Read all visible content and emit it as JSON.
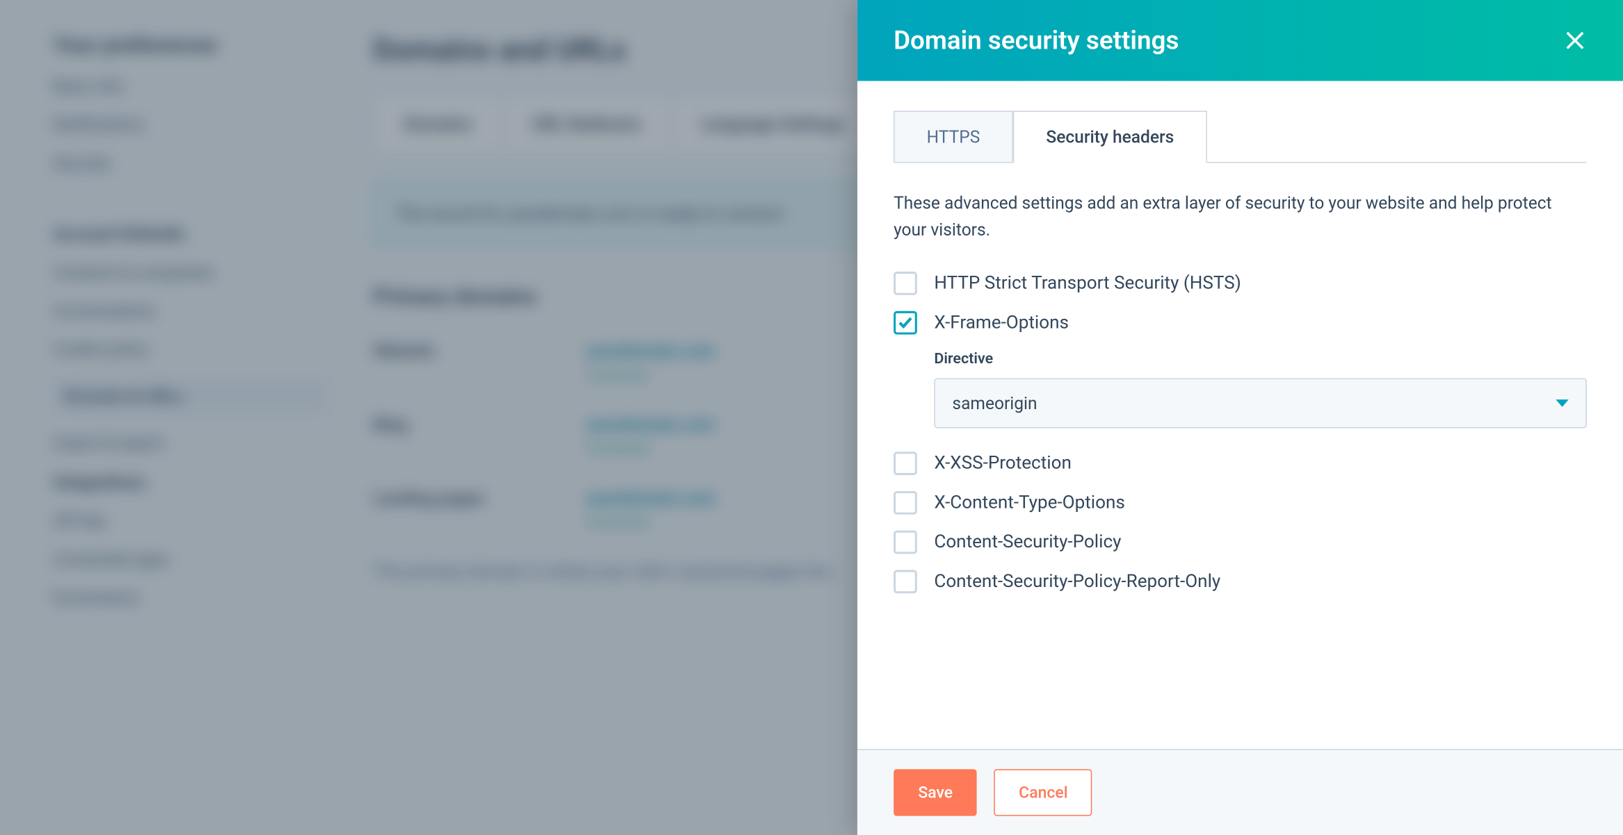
{
  "background": {
    "sidebar_heading": "Your preferences",
    "sidebar_items": [
      "Basic info",
      "Notifications",
      "Security"
    ],
    "sidebar_heading2": "Account Defaults",
    "sidebar_items2": [
      "Contacts & companies",
      "Conversations",
      "Cookie policy"
    ],
    "sidebar_selected": "Domains & URLs",
    "sidebar_items3": [
      "Import & export"
    ],
    "sidebar_heading3": "Integrations",
    "sidebar_items4": [
      "API key",
      "Connected apps",
      "Ecommerce"
    ],
    "page_title": "Domains and URLs",
    "tabs": [
      "Domains",
      "URL Redirects",
      "Language Settings"
    ],
    "alert": "The record for yourdomain.com is ready to connect.",
    "section": "Primary domains",
    "rows": [
      {
        "label": "Website",
        "value": "yourdomain.com",
        "status": "Connected"
      },
      {
        "label": "Blog",
        "value": "yourdomain.com",
        "status": "Connected"
      },
      {
        "label": "Landing pages",
        "value": "yourdomain.com",
        "status": "Connected"
      }
    ],
    "note": "The primary domain is where your site's canonical pages live."
  },
  "panel": {
    "title": "Domain security settings",
    "tabs": {
      "https": "HTTPS",
      "security_headers": "Security headers"
    },
    "description": "These advanced settings add an extra layer of security to your website and help protect your visitors.",
    "options": {
      "hsts": {
        "label": "HTTP Strict Transport Security (HSTS)",
        "checked": false
      },
      "xframe": {
        "label": "X-Frame-Options",
        "checked": true
      },
      "xss": {
        "label": "X-XSS-Protection",
        "checked": false
      },
      "xcto": {
        "label": "X-Content-Type-Options",
        "checked": false
      },
      "csp": {
        "label": "Content-Security-Policy",
        "checked": false
      },
      "cspro": {
        "label": "Content-Security-Policy-Report-Only",
        "checked": false
      }
    },
    "directive": {
      "label": "Directive",
      "value": "sameorigin"
    },
    "buttons": {
      "save": "Save",
      "cancel": "Cancel"
    }
  }
}
